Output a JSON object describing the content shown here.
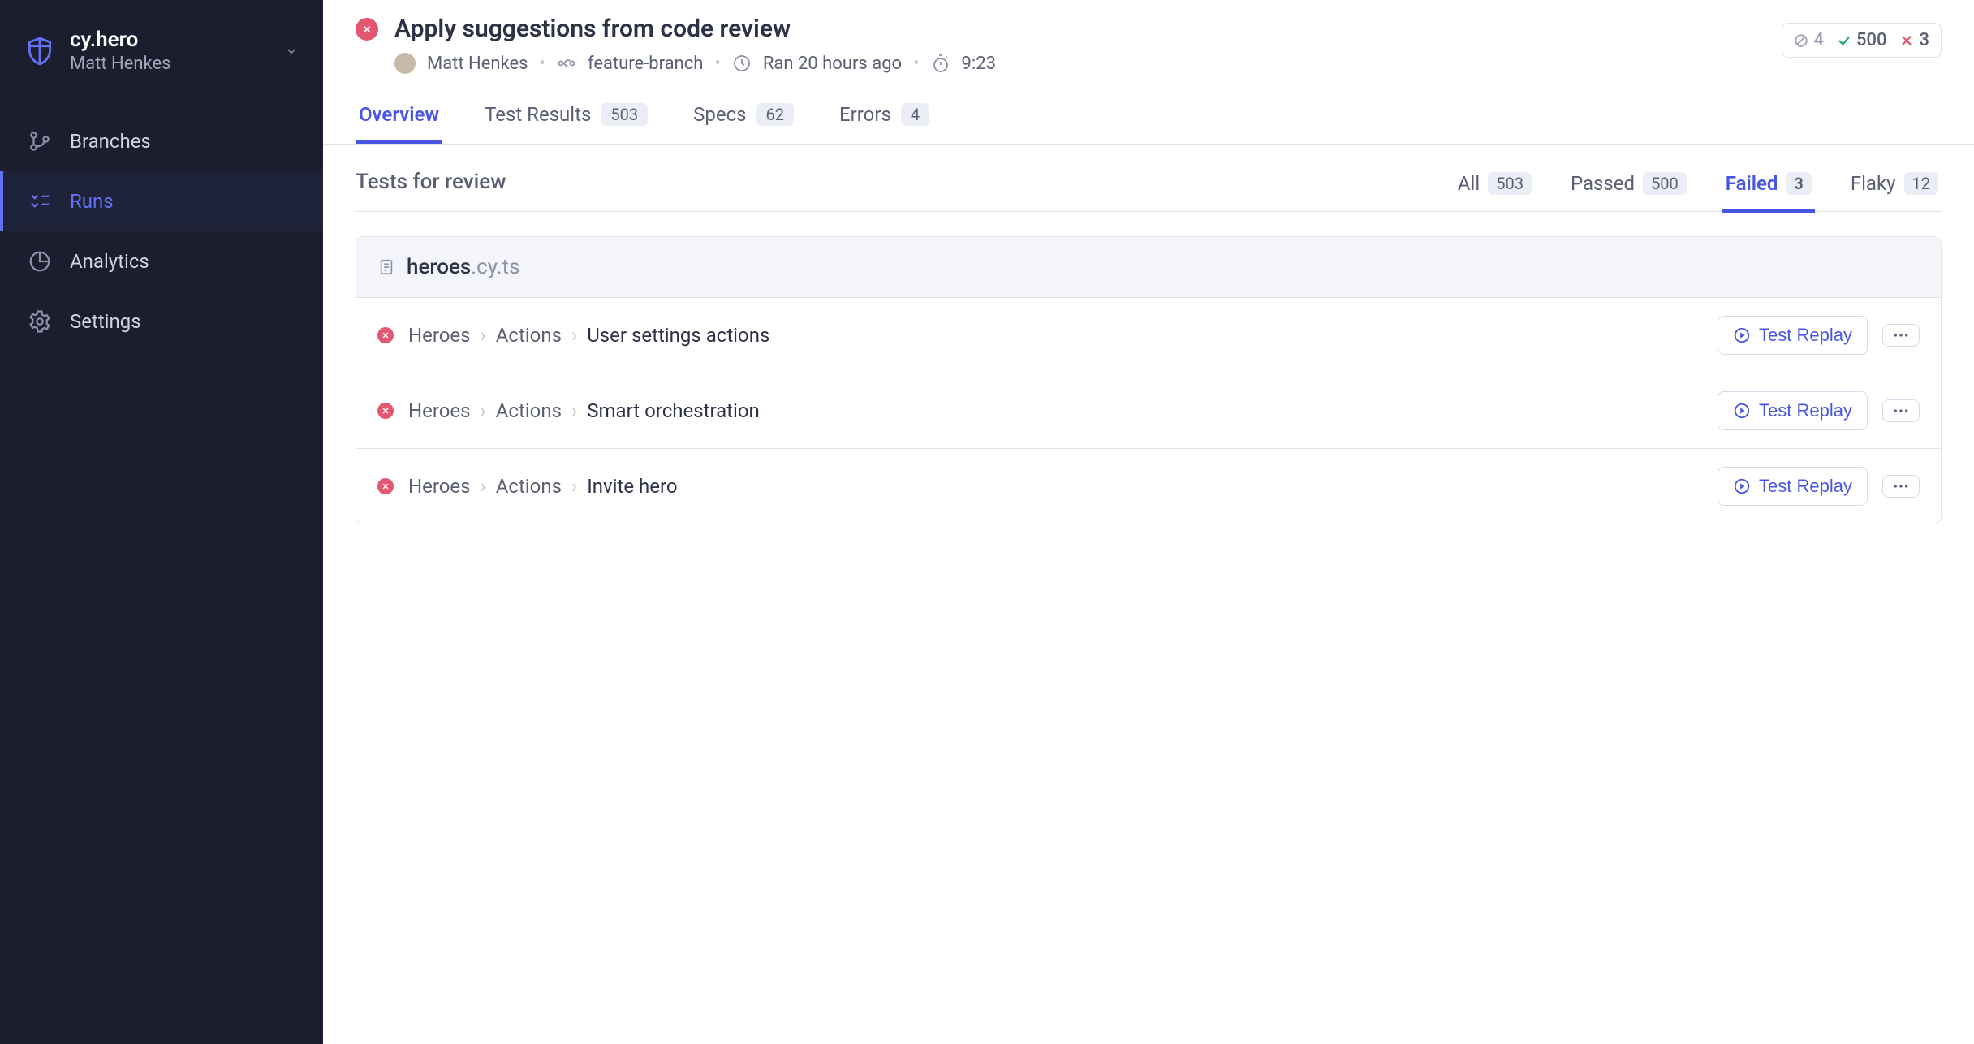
{
  "project": {
    "name": "cy.hero",
    "user": "Matt Henkes"
  },
  "nav": {
    "branches": "Branches",
    "runs": "Runs",
    "analytics": "Analytics",
    "settings": "Settings"
  },
  "run": {
    "title": "Apply suggestions from code review",
    "author": "Matt Henkes",
    "branch": "feature-branch",
    "ran": "Ran 20 hours ago",
    "duration": "9:23"
  },
  "stats": {
    "skipped": "4",
    "passed": "500",
    "failed": "3"
  },
  "tabs": {
    "overview": "Overview",
    "test_results": {
      "label": "Test Results",
      "count": "503"
    },
    "specs": {
      "label": "Specs",
      "count": "62"
    },
    "errors": {
      "label": "Errors",
      "count": "4"
    }
  },
  "review": {
    "title": "Tests for review",
    "filters": {
      "all": {
        "label": "All",
        "count": "503"
      },
      "passed": {
        "label": "Passed",
        "count": "500"
      },
      "failed": {
        "label": "Failed",
        "count": "3"
      },
      "flaky": {
        "label": "Flaky",
        "count": "12"
      }
    }
  },
  "spec": {
    "name": "heroes",
    "ext": ".cy.ts"
  },
  "tests": [
    {
      "crumb1": "Heroes",
      "crumb2": "Actions",
      "leaf": "User settings actions"
    },
    {
      "crumb1": "Heroes",
      "crumb2": "Actions",
      "leaf": "Smart orchestration"
    },
    {
      "crumb1": "Heroes",
      "crumb2": "Actions",
      "leaf": "Invite hero"
    }
  ],
  "buttons": {
    "replay": "Test Replay"
  }
}
